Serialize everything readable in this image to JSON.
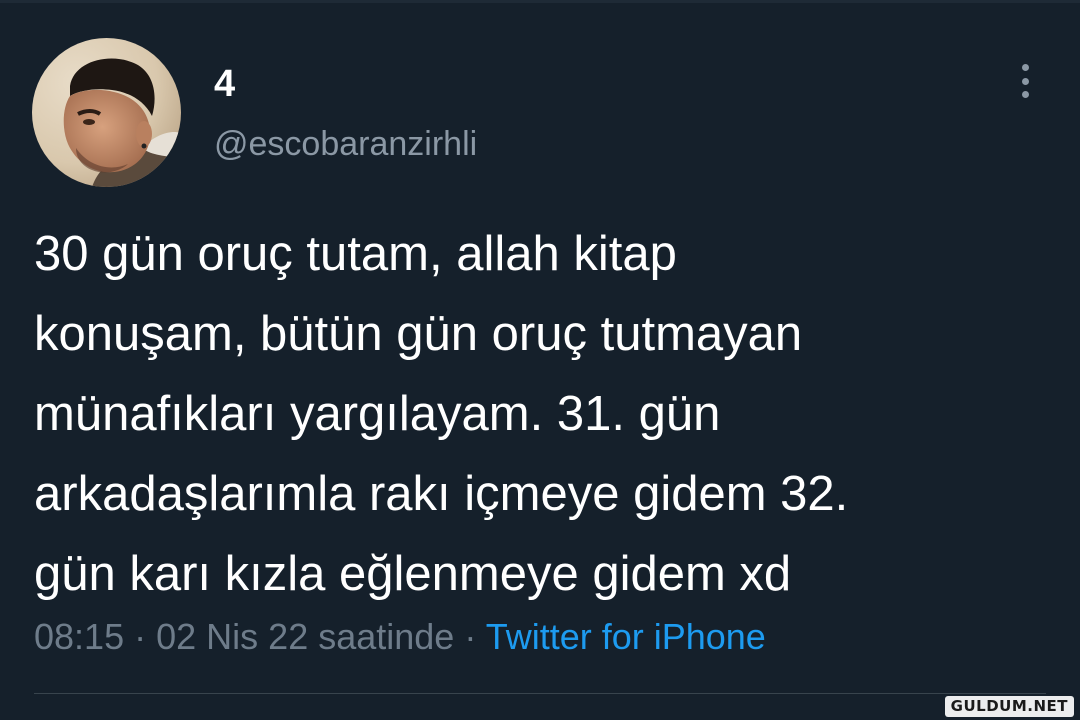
{
  "tweet": {
    "display_name": "4",
    "handle": "@escobaranzirhli",
    "text_lines": [
      "30 gün oruç tutam, allah kitap",
      "konuşam, bütün gün oruç tutmayan",
      "münafıkları yargılayam. 31. gün",
      "arkadaşlarımla rakı içmeye gidem 32.",
      "gün karı kızla eğlenmeye gidem xd"
    ],
    "time": "08:15",
    "date": "02 Nis 22 saatinde",
    "separator": "·",
    "source": "Twitter for iPhone"
  },
  "watermark": "GULDUM.NET",
  "colors": {
    "background": "#15202b",
    "text": "#ffffff",
    "secondary": "#8b98a5",
    "link": "#1d9bf0"
  },
  "icons": {
    "more": "more-vertical-icon"
  }
}
